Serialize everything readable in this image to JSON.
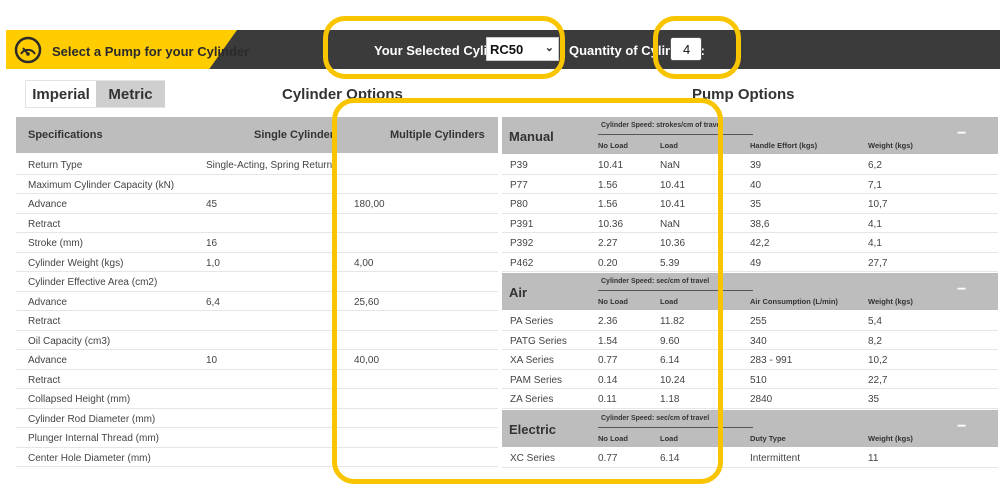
{
  "header": {
    "title": "Select a Pump for your Cylinder",
    "selected_label": "Your Selected Cylinder:",
    "selected_value": "RC50",
    "quantity_label": "Quantity of Cylinders:",
    "quantity_value": "4",
    "accent_color": "#ffcc00",
    "bar_color": "#3b3b3b",
    "icon": "gauge-icon"
  },
  "units": {
    "imperial": "Imperial",
    "metric": "Metric",
    "active": "Metric"
  },
  "cylinder_options": {
    "title": "Cylinder Options",
    "columns": [
      "Specifications",
      "Single Cylinder",
      "Multiple Cylinders"
    ],
    "rows": [
      [
        "Return Type",
        "Single-Acting, Spring Return",
        ""
      ],
      [
        "Maximum Cylinder Capacity (kN)",
        "",
        ""
      ],
      [
        "Advance",
        "45",
        "180,00"
      ],
      [
        "Retract",
        "",
        ""
      ],
      [
        "Stroke (mm)",
        "16",
        ""
      ],
      [
        "Cylinder Weight (kgs)",
        "1,0",
        "4,00"
      ],
      [
        "Cylinder Effective Area (cm2)",
        "",
        ""
      ],
      [
        "Advance",
        "6,4",
        "25,60"
      ],
      [
        "Retract",
        "",
        ""
      ],
      [
        "Oil Capacity (cm3)",
        "",
        ""
      ],
      [
        "Advance",
        "10",
        "40,00"
      ],
      [
        "Retract",
        "",
        ""
      ],
      [
        "Collapsed Height (mm)",
        "",
        ""
      ],
      [
        "Cylinder Rod Diameter (mm)",
        "",
        ""
      ],
      [
        "Plunger Internal Thread (mm)",
        "",
        ""
      ],
      [
        "Center Hole Diameter (mm)",
        "",
        ""
      ]
    ]
  },
  "pump_options": {
    "title": "Pump Options",
    "collapse_symbol": "−",
    "groups": [
      {
        "name": "Manual",
        "speed_label": "Cylinder Speed: strokes/cm of travel",
        "columns": [
          "No Load",
          "Load",
          "Handle Effort (kgs)",
          "Weight (kgs)"
        ],
        "rows": [
          [
            "P39",
            "10.41",
            "NaN",
            "39",
            "6,2"
          ],
          [
            "P77",
            "1.56",
            "10.41",
            "40",
            "7,1"
          ],
          [
            "P80",
            "1.56",
            "10.41",
            "35",
            "10,7"
          ],
          [
            "P391",
            "10.36",
            "NaN",
            "38,6",
            "4,1"
          ],
          [
            "P392",
            "2.27",
            "10.36",
            "42,2",
            "4,1"
          ],
          [
            "P462",
            "0.20",
            "5.39",
            "49",
            "27,7"
          ]
        ]
      },
      {
        "name": "Air",
        "speed_label": "Cylinder Speed: sec/cm of travel",
        "columns": [
          "No Load",
          "Load",
          "Air Consumption (L/min)",
          "Weight (kgs)"
        ],
        "rows": [
          [
            "PA Series",
            "2.36",
            "11.82",
            "255",
            "5,4"
          ],
          [
            "PATG Series",
            "1.54",
            "9.60",
            "340",
            "8,2"
          ],
          [
            "XA Series",
            "0.77",
            "6.14",
            "283 - 991",
            "10,2"
          ],
          [
            "PAM Series",
            "0.14",
            "10.24",
            "510",
            "22,7"
          ],
          [
            "ZA Series",
            "0.11",
            "1.18",
            "2840",
            "35"
          ]
        ]
      },
      {
        "name": "Electric",
        "speed_label": "Cylinder Speed: sec/cm of travel",
        "columns": [
          "No Load",
          "Load",
          "Duty Type",
          "Weight (kgs)"
        ],
        "rows": [
          [
            "XC Series",
            "0.77",
            "6.14",
            "Intermittent",
            "11"
          ]
        ]
      }
    ]
  }
}
